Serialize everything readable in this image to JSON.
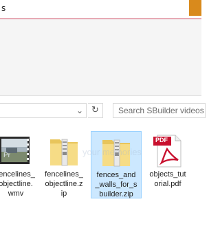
{
  "window": {
    "title": "s"
  },
  "address": {
    "dropdown_glyph": "⌄",
    "refresh_glyph": "↻"
  },
  "search": {
    "placeholder": "Search SBuilder videos"
  },
  "files": [
    {
      "name": "fencelines_\nobjectline.\nwmv",
      "type": "video",
      "icon": "video-thumbnail-icon"
    },
    {
      "name": "fencelines_\nobjectline.z\nip",
      "type": "zip",
      "icon": "zip-folder-icon"
    },
    {
      "name": "fences_and\n_walls_for_s\nbuilder.zip",
      "type": "zip",
      "icon": "zip-folder-icon",
      "selected": true
    },
    {
      "name": "objects_tut\norial.pdf",
      "type": "pdf",
      "icon": "pdf-icon",
      "badge": "PDF"
    }
  ],
  "watermark": {
    "text": "your memories"
  },
  "colors": {
    "selection": "#cce8ff",
    "selection_border": "#99d1ff",
    "pdf_red": "#c8102e"
  }
}
